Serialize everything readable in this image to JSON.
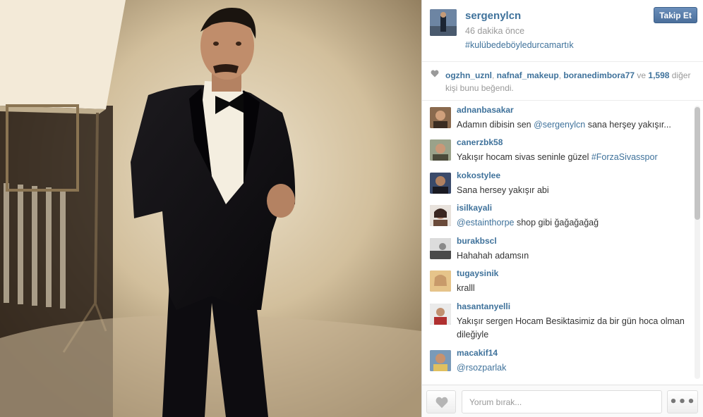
{
  "post": {
    "username": "sergenylcn",
    "time": "46 dakika önce",
    "hashtag": "#kulübedeböyledurcamartık",
    "follow_label": "Takip Et"
  },
  "likes": {
    "user1": "ogzhn_uznl",
    "sep1": ", ",
    "user2": "nafnaf_makeup",
    "sep2": ", ",
    "user3": "boranedimbora77",
    "connector": " ve ",
    "count": "1,598",
    "suffix": " diğer kişi bunu beğendi."
  },
  "comments": [
    {
      "user": "adnanbasakar",
      "text_pre": "Adamın dibisin sen ",
      "mention": "@sergenylcn",
      "text_post": " sana herşey yakışır..."
    },
    {
      "user": "canerzbk58",
      "text_pre": "Yakışır hocam sivas seninle güzel ",
      "mention": "#ForzaSivasspor",
      "text_post": ""
    },
    {
      "user": "kokostylee",
      "text_pre": "Sana hersey yakışır abi",
      "mention": "",
      "text_post": ""
    },
    {
      "user": "isilkayali",
      "text_pre": "",
      "mention": "@estainthorpe",
      "text_post": " shop gibi ğağağağağ"
    },
    {
      "user": "burakbscl",
      "text_pre": "Hahahah adamsın",
      "mention": "",
      "text_post": ""
    },
    {
      "user": "tugaysinik",
      "text_pre": "kralll",
      "mention": "",
      "text_post": ""
    },
    {
      "user": "hasantanyelli",
      "text_pre": "Yakışır sergen Hocam Besiktasimiz da bir gün hoca olman dileğiyle",
      "mention": "",
      "text_post": ""
    },
    {
      "user": "macakif14",
      "text_pre": "",
      "mention": "@rsozparlak",
      "text_post": ""
    }
  ],
  "footer": {
    "comment_placeholder": "Yorum bırak...",
    "more_label": "•••"
  },
  "colors": {
    "link": "#3f729b",
    "follow_button": "#4b6f9b"
  },
  "icons": [
    "heart-icon",
    "more-options-icon"
  ]
}
